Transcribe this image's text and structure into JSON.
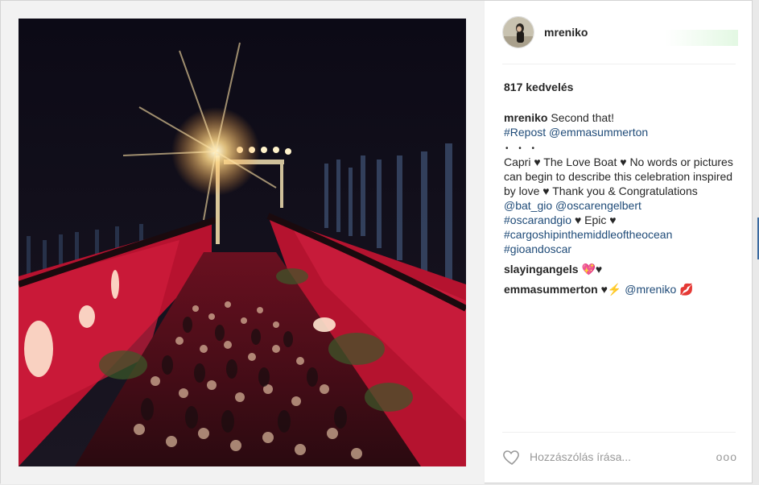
{
  "post": {
    "username": "mreniko",
    "likes": "817 kedvelés",
    "caption": {
      "user": "mreniko",
      "line1": "Second that!",
      "repost_tag": "#Repost",
      "repost_user": "@emmasummerton",
      "dots": "• • •",
      "text_part1": "Capri ♥ The Love Boat ♥ No words or pictures can begin to describe this celebration inspired by love ♥ Thank you & Congratulations",
      "mention_1": "@bat_gio",
      "mention_2": "@oscarengelbert",
      "tag_1": "#oscarandgio",
      "text_part2": "♥ Epic ♥",
      "tag_2": "#cargoshipinthemiddleoftheocean",
      "tag_3": "#gioandoscar"
    },
    "comments": [
      {
        "user": "slayingangels",
        "text": "💖♥"
      },
      {
        "user": "emmasummerton",
        "text_prefix": "♥⚡",
        "mention": "@mreniko",
        "text_suffix": "💋"
      }
    ],
    "add_comment_placeholder": "Hozzászólás írása...",
    "more_label": "ooo"
  },
  "icons": {
    "like": "heart-icon",
    "more": "more-options-icon",
    "avatar": "avatar"
  },
  "colors": {
    "link": "#1f4b78",
    "text": "#262626",
    "muted": "#999999",
    "photo_red": "#c2183a"
  }
}
